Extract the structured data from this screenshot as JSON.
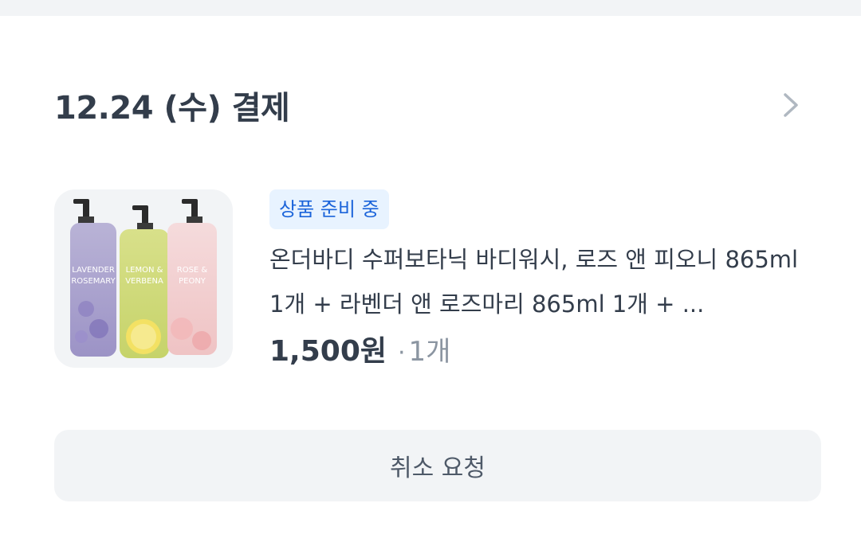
{
  "order": {
    "date_title": "12.24 (수) 결제",
    "detail_icon": "chevron-right-icon"
  },
  "product": {
    "status": "상품 준비 중",
    "name": "온더바디 수퍼보타닉 바디워시, 로즈 앤 피오니 865ml 1개 + 라벤더 앤 로즈마리 865ml 1개 + ...",
    "price": "1,500원",
    "qty_separator": "·",
    "quantity": "1개",
    "image": {
      "bottle_labels": [
        [
          "LAVENDER",
          "ROSEMARY"
        ],
        [
          "LEMON &",
          "VERBENA"
        ],
        [
          "ROSE &",
          "PEONY"
        ]
      ]
    }
  },
  "actions": {
    "cancel_label": "취소 요청"
  },
  "colors": {
    "badge_bg": "#e8f3ff",
    "badge_text": "#1b64da",
    "button_bg": "#f2f4f6"
  }
}
